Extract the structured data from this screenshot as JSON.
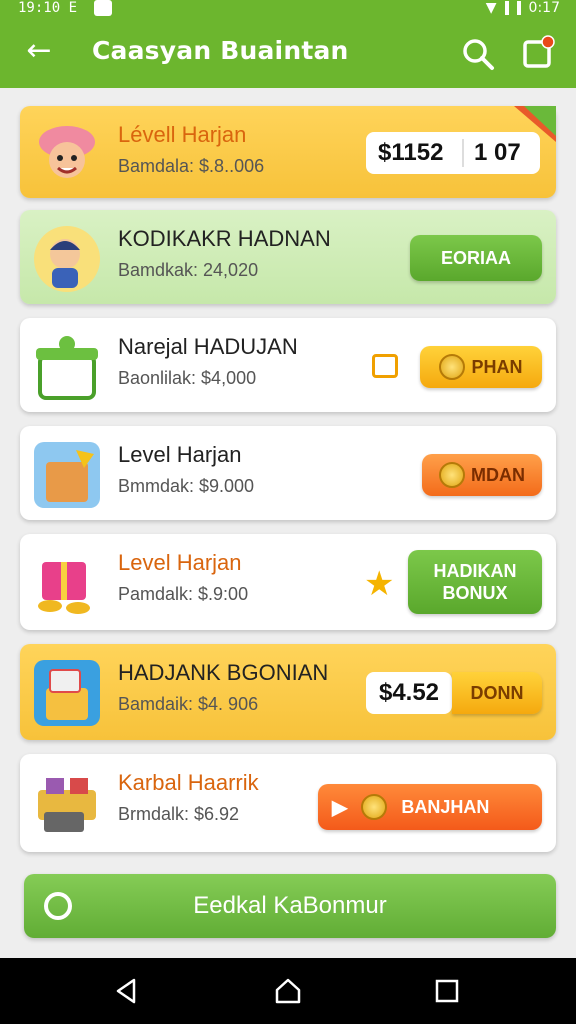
{
  "status_bar": {
    "time": "19:10 E",
    "clock_right": "0:17",
    "badge": "✔"
  },
  "app_bar": {
    "title": "Caasyan Buaintan"
  },
  "items": [
    {
      "name": "Lévell Harjan",
      "sub": "Bamdala: $.8..006",
      "price_left": "$1152",
      "price_right": "1 07",
      "tag": "✕"
    },
    {
      "name": "KODIKAKR HADNAN",
      "sub": "Bamdkak: 24,020",
      "button": "EORIAA"
    },
    {
      "name": "Narejal HADUJAN",
      "sub": "Baonlilak: $4,000",
      "button": "PHAN"
    },
    {
      "name": "Level Harjan",
      "sub": "Bmmdak: $9.000",
      "button": "MDAN"
    },
    {
      "name": "Level Harjan",
      "sub": "Pamdalk: $.9:00",
      "button_line1": "HADIKAN",
      "button_line2": "BONUX"
    },
    {
      "name": "HADJANK BGONIAN",
      "sub": "Bamdaik: $4. 906",
      "price": "$4.52",
      "button": "DONN"
    },
    {
      "name": "Karbal Haarrik",
      "sub": "Brmdalk: $6.92",
      "button": "BANJHAN"
    }
  ],
  "footer": {
    "label": "Eedkal KaBonmur"
  },
  "colors": {
    "appbar": "#6cb62e",
    "green_button": "#5aa82c",
    "yellow_card": "#f7c23a",
    "orange_button": "#f36b1a"
  }
}
